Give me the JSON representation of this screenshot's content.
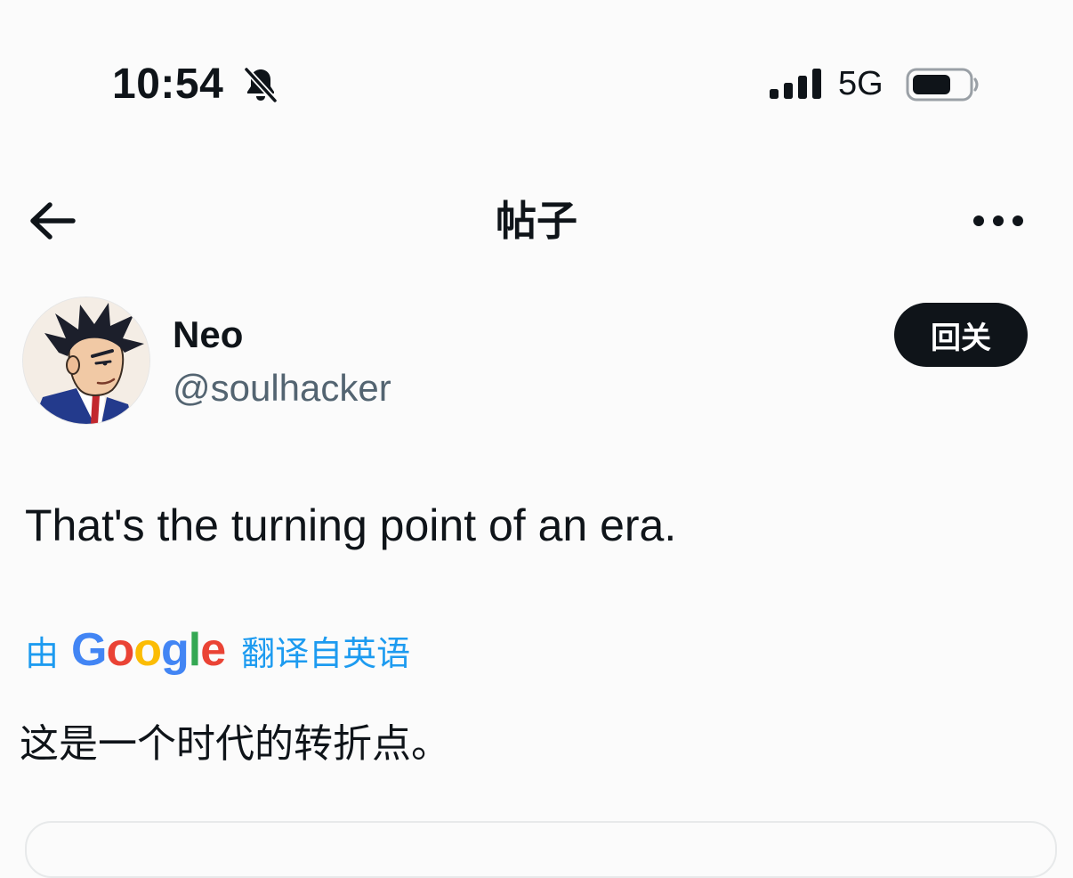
{
  "status_bar": {
    "time": "10:54",
    "network": "5G",
    "icons": [
      "bell-slash-icon",
      "signal-icon",
      "battery-icon"
    ]
  },
  "header": {
    "title": "帖子",
    "back_icon": "arrow-left-icon",
    "more_icon": "more-horizontal-icon"
  },
  "author": {
    "name": "Neo",
    "handle": "@soulhacker",
    "follow_label": "回关"
  },
  "post": {
    "text": "That's the turning point of an era.",
    "translate_prefix": "由",
    "translate_brand": "Google",
    "translate_suffix": "翻译自英语",
    "translated_text": "这是一个时代的转折点。"
  },
  "colors": {
    "background": "#fbfbfb",
    "text": "#0f1419",
    "secondary": "#536471",
    "link": "#1d9bf0",
    "button": "#0f1419"
  }
}
